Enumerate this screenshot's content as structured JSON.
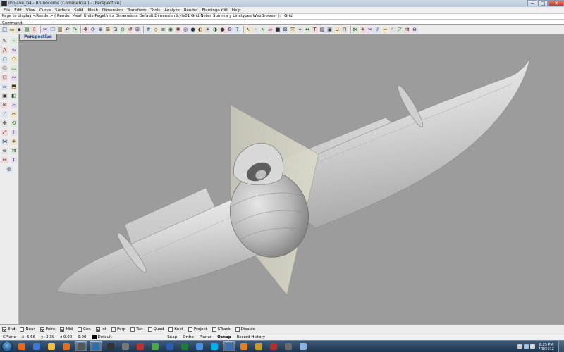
{
  "window": {
    "title": "mojave_04 - Rhinoceros (Commercial) - [Perspective]",
    "buttons": [
      "─",
      "□",
      "✕"
    ]
  },
  "menu": [
    "File",
    "Edit",
    "View",
    "Curve",
    "Surface",
    "Solid",
    "Mesh",
    "Dimension",
    "Transform",
    "Tools",
    "Analyze",
    "Render",
    "Flamingo nXt",
    "Help"
  ],
  "command_history": "Page to display <Render> ( Render  Mesh  Units  PageUnits  Dimensions  Default  DimensionStyle01  Grid  Notes  Summary  Linetypes  WebBrowser ): _Grid",
  "command_line": {
    "label": "Command:",
    "value": ""
  },
  "toolbar": {
    "icons": [
      "new-file-icon",
      "open-file-icon",
      "save-icon",
      "print-icon",
      "import-icon",
      "cut-icon",
      "copy-icon",
      "paste-icon",
      "undo-icon",
      "redo-icon",
      "pan-icon",
      "rotate-view-icon",
      "zoom-icon",
      "zoom-window-icon",
      "zoom-extents-icon",
      "zoom-selected-icon",
      "undo-view-icon",
      "four-viewports-icon",
      "grid-icon",
      "cplane-icon",
      "layer-icon",
      "object-properties-icon",
      "light-icon",
      "wireframe-icon",
      "shaded-icon",
      "rendered-icon",
      "render-icon",
      "render-preview-icon",
      "sphere-icon",
      "options-icon",
      "help-icon",
      "select-icon",
      "point-icon",
      "curve-icon",
      "surface-icon",
      "solid-icon",
      "mesh-icon",
      "transform-icon",
      "analyze-icon",
      "dimension-icon",
      "text-icon",
      "hatch-icon",
      "block-icon",
      "group-icon",
      "ungroup-icon",
      "join-icon",
      "explode-icon",
      "trim-icon",
      "split-icon",
      "extend-icon",
      "fillet-icon",
      "chamfer-icon",
      "offset-icon",
      "boolean-icon"
    ]
  },
  "left_toolbar": {
    "icons": [
      "select-arrow-icon",
      "point-icon",
      "polyline-icon",
      "curve-icon",
      "circle-icon",
      "arc-icon",
      "ellipse-icon",
      "rectangle-icon",
      "polygon-icon",
      "freeform-icon",
      "surface-icon",
      "extrude-icon",
      "solid-box-icon",
      "solid-edit-icon",
      "mesh-icon",
      "loft-icon",
      "fillet-icon",
      "trim-icon",
      "move-icon",
      "rotate-icon",
      "scale-icon",
      "array-icon",
      "join-icon",
      "explode-icon",
      "boolean-icon",
      "offset-icon",
      "dimension-icon",
      "text-icon",
      "render-sphere-icon"
    ]
  },
  "viewport": {
    "label": "Perspective",
    "background": "#9c9c9c"
  },
  "osnaps": [
    {
      "label": "End",
      "checked": true
    },
    {
      "label": "Near",
      "checked": false
    },
    {
      "label": "Point",
      "checked": true
    },
    {
      "label": "Mid",
      "checked": true
    },
    {
      "label": "Cen",
      "checked": false
    },
    {
      "label": "Int",
      "checked": true
    },
    {
      "label": "Perp",
      "checked": false
    },
    {
      "label": "Tan",
      "checked": false
    },
    {
      "label": "Quad",
      "checked": false
    },
    {
      "label": "Knot",
      "checked": false
    },
    {
      "label": "Project",
      "checked": false
    },
    {
      "label": "STrack",
      "checked": false
    },
    {
      "label": "Disable",
      "checked": false
    }
  ],
  "status": {
    "cplane": "CPlane",
    "x": "x -6.66",
    "y": "y -2.39",
    "z": "z 0.00",
    "distance": "0.00",
    "layer": "Default",
    "toggles": [
      {
        "label": "Snap",
        "active": false
      },
      {
        "label": "Ortho",
        "active": false
      },
      {
        "label": "Planar",
        "active": false
      },
      {
        "label": "Osnap",
        "active": true
      },
      {
        "label": "Record History",
        "active": false
      }
    ]
  },
  "taskbar": {
    "apps": [
      "firefox-icon",
      "explorer-icon",
      "folder-icon",
      "media-player-icon",
      "rhino-icon",
      "photoshop-icon",
      "steam-icon",
      "camera-icon",
      "flamingo-icon",
      "paint-icon",
      "word-icon",
      "excel-icon",
      "chrome-icon",
      "skype-icon",
      "network-icon",
      "blender-icon",
      "winamp-icon",
      "sketchup-icon",
      "calculator-icon",
      "notepad-icon"
    ],
    "clock_time": "8:25 PM",
    "clock_date": "7/8/2012"
  },
  "colors": {
    "viewport_bg": "#9c9c9c",
    "accent": "#1b3f8b",
    "taskbar": "#1d3550"
  }
}
